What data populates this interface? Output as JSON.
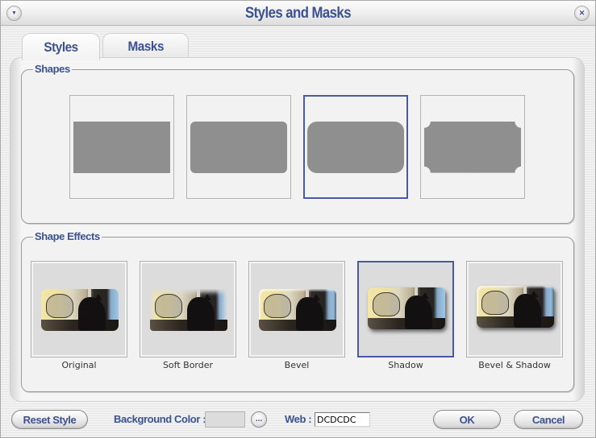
{
  "window": {
    "title": "Styles and Masks",
    "menu_icon": "chevron-down-icon",
    "close_icon": "close-icon",
    "menu_glyph": "▼",
    "close_glyph": "✕"
  },
  "tabs": [
    {
      "label": "Styles",
      "active": true
    },
    {
      "label": "Masks",
      "active": false
    }
  ],
  "shapes": {
    "label": "Shapes",
    "items": [
      {
        "name": "rectangle",
        "selected": false
      },
      {
        "name": "rounded-rectangle",
        "selected": false
      },
      {
        "name": "large-rounded-rectangle",
        "selected": true
      },
      {
        "name": "notched-rectangle",
        "selected": false
      }
    ]
  },
  "effects": {
    "label": "Shape Effects",
    "items": [
      {
        "label": "Original",
        "selected": false
      },
      {
        "label": "Soft Border",
        "selected": false
      },
      {
        "label": "Bevel",
        "selected": false
      },
      {
        "label": "Shadow",
        "selected": true
      },
      {
        "label": "Bevel & Shadow",
        "selected": false
      }
    ]
  },
  "footer": {
    "reset_label": "Reset Style",
    "background_color_label": "Background Color :",
    "background_color": "#DCDCDC",
    "ellipsis_label": "...",
    "web_label": "Web :",
    "web_value": "DCDCDC",
    "ok_label": "OK",
    "cancel_label": "Cancel"
  },
  "colors": {
    "accent": "#3c5190",
    "selection_border": "#4a5aa0",
    "shape_fill": "#8f8f8f"
  }
}
